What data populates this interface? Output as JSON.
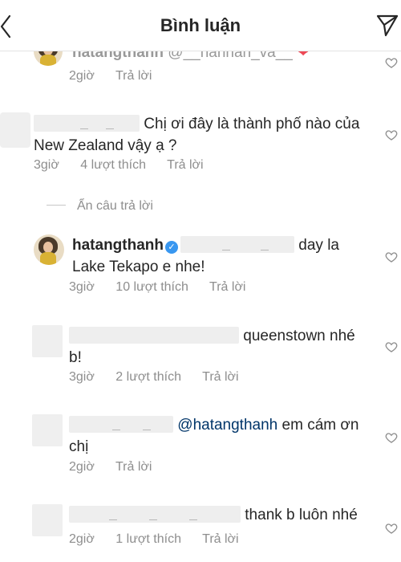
{
  "header": {
    "title": "Bình luận"
  },
  "comments": [
    {
      "user": "hatangthanh",
      "text_visible": "@__hannan_va__",
      "meta": {
        "time": "2giờ",
        "likes": "",
        "reply": "Trả lời"
      }
    },
    {
      "text1": "Chị ơi đây là thành phố nào của",
      "text2": "New Zealand vậy ạ ?",
      "meta": {
        "time": "3giờ",
        "likes": "4 lượt thích",
        "reply": "Trả lời"
      }
    },
    {
      "user": "hatangthanh",
      "text1": "day la",
      "text2": "Lake Tekapo e nhe!",
      "meta": {
        "time": "3giờ",
        "likes": "10 lượt thích",
        "reply": "Trả lời"
      }
    },
    {
      "text1": "queenstown nhé",
      "text2": "b!",
      "meta": {
        "time": "3giờ",
        "likes": "2 lượt thích",
        "reply": "Trả lời"
      }
    },
    {
      "mention": "@hatangthanh",
      "text1": "em cám ơn",
      "text2": "chị",
      "meta": {
        "time": "2giờ",
        "likes": "",
        "reply": "Trả lời"
      }
    },
    {
      "text1": "thank b luôn nhé",
      "meta": {
        "time": "2giờ",
        "likes": "1 lượt thích",
        "reply": "Trả lời"
      }
    }
  ],
  "hidden_replies_label": "Ẩn câu trả lời",
  "icons": {
    "back": "chevron-left-icon",
    "send": "paper-plane-icon",
    "like": "heart-outline-icon",
    "verified": "verified-badge-icon"
  },
  "colors": {
    "text": "#262626",
    "meta": "#8e8e8e",
    "verified": "#3897f0"
  }
}
